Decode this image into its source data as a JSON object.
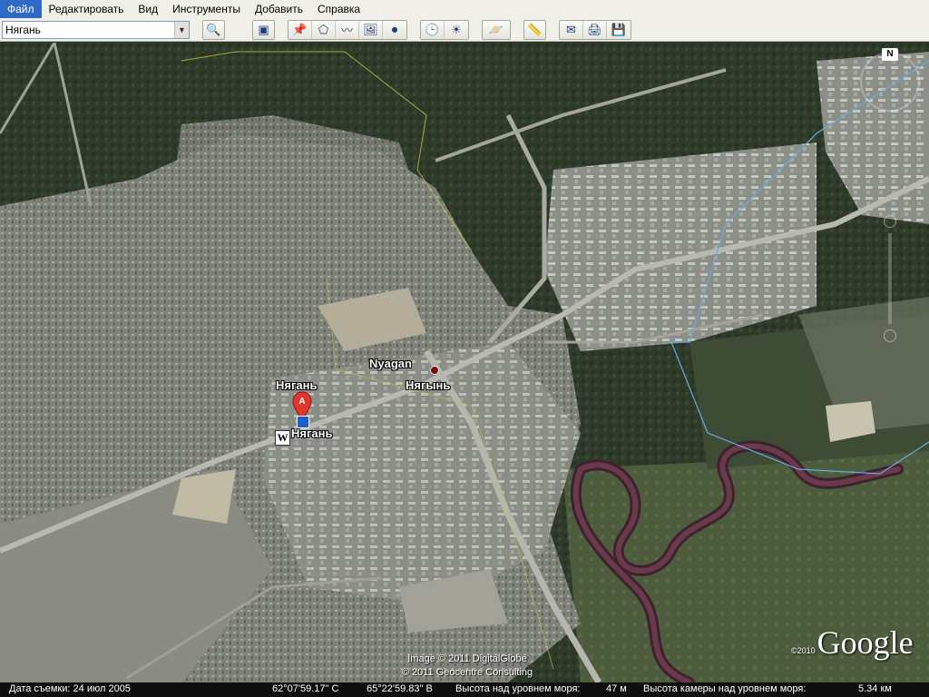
{
  "menu": [
    "Файл",
    "Редактировать",
    "Вид",
    "Инструменты",
    "Добавить",
    "Справка"
  ],
  "toolbar": {
    "search_value": "Нягань",
    "dropdown_glyph": "▼",
    "search_button_glyph": "🔍",
    "buttons": [
      {
        "name": "sidebar-toggle-icon",
        "glyph": "▣"
      },
      {
        "name": "placemark-icon",
        "glyph": "📌"
      },
      {
        "name": "polygon-icon",
        "glyph": "⬠"
      },
      {
        "name": "path-icon",
        "glyph": "〰"
      },
      {
        "name": "image-overlay-icon",
        "glyph": "🖼"
      },
      {
        "name": "tour-record-icon",
        "glyph": "⏺"
      },
      {
        "name": "historical-imagery-icon",
        "glyph": "🕒"
      },
      {
        "name": "sunlight-icon",
        "glyph": "☀"
      },
      {
        "name": "planets-icon",
        "glyph": "🪐"
      },
      {
        "name": "ruler-icon",
        "glyph": "📏"
      },
      {
        "name": "email-icon",
        "glyph": "✉"
      },
      {
        "name": "print-icon",
        "glyph": "🖨"
      },
      {
        "name": "save-image-icon",
        "glyph": "💾"
      }
    ]
  },
  "map": {
    "labels": {
      "nyagan_latin": "Nyagan",
      "nyagyn": "Нягынь",
      "nyagan_top": "Нягань",
      "nyagan_station": "Нягань"
    },
    "pin_letter": "A",
    "rail_glyph": "🚉",
    "wiki_glyph": "W",
    "compass_n": "N",
    "credits": [
      "Image © 2011 DigitalGlobe",
      "© 2011 Geocentre Consulting"
    ],
    "google": {
      "year": "©2010",
      "brand": "Google"
    }
  },
  "status": {
    "date_label": "Дата съемки: 24 июл 2005",
    "lat": "62°07'59.17\" С",
    "lon": "65°22'59.83\" В",
    "elev_label": "Высота над уровнем моря:",
    "elev_value": "47 м",
    "cam_label": "Высота камеры над уровнем моря:",
    "cam_value": "5.34 км"
  },
  "colors": {
    "forest": "#2f3c2a",
    "urban": "#8d8f86",
    "river": "#5a2e3c",
    "border_line": "#6aa9e0",
    "pin": "#e0362b"
  }
}
